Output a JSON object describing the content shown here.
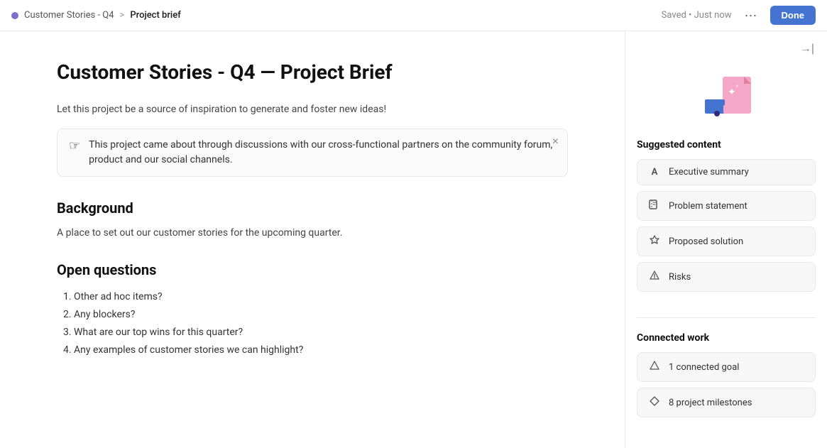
{
  "topbar": {
    "project_name": "Customer Stories - Q4",
    "breadcrumb_sep": ">",
    "current_page": "Project brief",
    "saved_status": "Saved • Just now",
    "more_icon": "•••",
    "done_label": "Done"
  },
  "doc": {
    "title": "Customer Stories - Q4 — Project Brief",
    "subtitle": "Let this project be a source of inspiration to generate and foster new ideas!",
    "notice_text": "This project came about through discussions with our cross-functional partners on the community forum, product and our social channels.",
    "background_heading": "Background",
    "background_text": "A place to set out our customer stories for the upcoming quarter.",
    "open_questions_heading": "Open questions",
    "questions": [
      "Other ad hoc items?",
      "Any blockers?",
      "What are our top wins for this quarter?",
      "Any examples of customer stories we can highlight?"
    ]
  },
  "sidebar": {
    "suggested_content_title": "Suggested content",
    "cards": [
      {
        "icon": "A",
        "label": "Executive summary"
      },
      {
        "icon": "⚑",
        "label": "Problem statement"
      },
      {
        "icon": "☆",
        "label": "Proposed solution"
      },
      {
        "icon": "△",
        "label": "Risks"
      }
    ],
    "connected_work_title": "Connected work",
    "connected_items": [
      {
        "icon": "△",
        "label": "1 connected goal"
      },
      {
        "icon": "◇",
        "label": "8 project milestones"
      }
    ]
  }
}
